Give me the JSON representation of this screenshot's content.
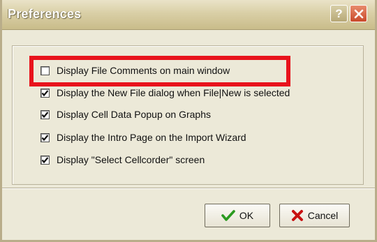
{
  "window": {
    "title": "Preferences"
  },
  "titlebar_buttons": {
    "help": "?",
    "close_icon": "close-icon"
  },
  "options": [
    {
      "label": "Display File Comments on main window",
      "checked": false
    },
    {
      "label": "Display the New File dialog when File|New is selected",
      "checked": true
    },
    {
      "label": "Display Cell Data Popup on Graphs",
      "checked": true
    },
    {
      "label": "Display the Intro Page on the Import Wizard",
      "checked": true
    },
    {
      "label": "Display \"Select Cellcorder\" screen",
      "checked": true
    }
  ],
  "buttons": {
    "ok_label": "OK",
    "ok_icon": "checkmark-icon",
    "cancel_label": "Cancel",
    "cancel_icon": "x-icon"
  },
  "colors": {
    "highlight": "#e8131c",
    "ok_icon": "#2a9a1f",
    "cancel_icon": "#c81212"
  }
}
